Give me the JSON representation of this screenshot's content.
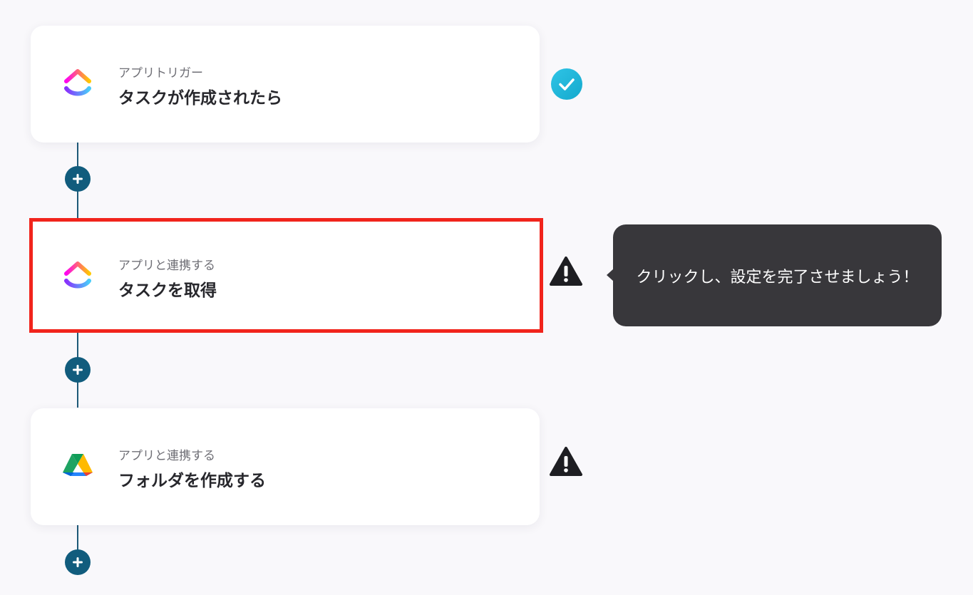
{
  "steps": [
    {
      "subtitle": "アプリトリガー",
      "title": "タスクが作成されたら",
      "app_icon": "clickup-icon",
      "status": "complete"
    },
    {
      "subtitle": "アプリと連携する",
      "title": "タスクを取得",
      "app_icon": "clickup-icon",
      "status": "warning",
      "highlighted": true
    },
    {
      "subtitle": "アプリと連携する",
      "title": "フォルダを作成する",
      "app_icon": "google-drive-icon",
      "status": "warning"
    }
  ],
  "tooltip": {
    "text": "クリックし、設定を完了させましょう！"
  },
  "colors": {
    "background": "#f9f8fb",
    "connector": "#115c7d",
    "highlight_border": "#f1241c",
    "success": "#1ab3d6",
    "warning": "#1e1e22",
    "tooltip_bg": "#38373b"
  }
}
